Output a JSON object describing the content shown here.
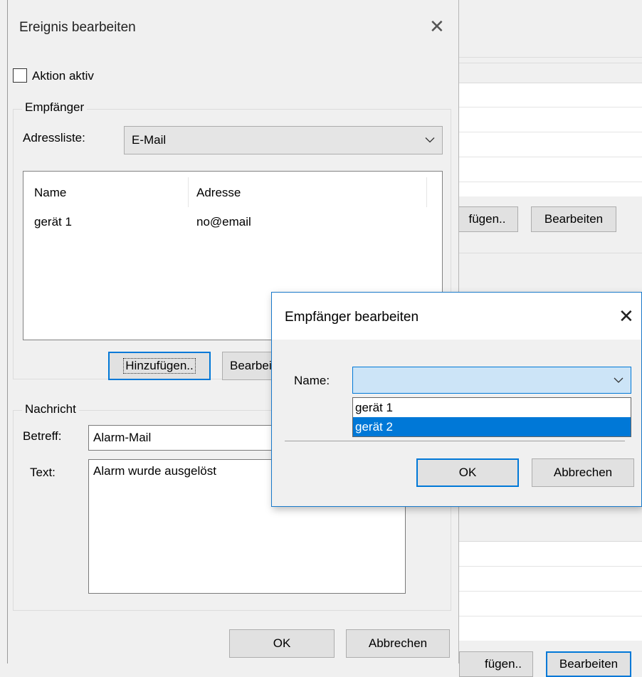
{
  "main_dialog": {
    "title": "Ereignis bearbeiten",
    "action_active_label": "Aktion aktiv",
    "recipients_group": {
      "legend": "Empfänger",
      "address_list_label": "Adressliste:",
      "address_list_value": "E-Mail",
      "columns": [
        "Name",
        "Adresse"
      ],
      "rows": [
        {
          "name": "gerät 1",
          "address": "no@email"
        }
      ],
      "add_button": "Hinzufügen..",
      "edit_button": "Bearbeiten"
    },
    "message_group": {
      "legend": "Nachricht",
      "subject_label": "Betreff:",
      "subject_value": "Alarm-Mail",
      "text_label": "Text:",
      "text_value": "Alarm wurde ausgelöst"
    },
    "ok_button": "OK",
    "cancel_button": "Abbrechen"
  },
  "background_window": {
    "add_button_partial": "fügen..",
    "edit_button": "Bearbeiten",
    "bottom_button_1_partial": "fügen..",
    "bottom_button_2_partial": "Bearbeiten"
  },
  "edit_recipient_dialog": {
    "title": "Empfänger bearbeiten",
    "name_label": "Name:",
    "name_value": "",
    "options": [
      "gerät 1",
      "gerät 2"
    ],
    "selected_option_index": 1,
    "ok_button": "OK",
    "cancel_button": "Abbrechen"
  },
  "colors": {
    "accent": "#0078d7",
    "window_bg": "#f0f0f0",
    "combo_focus_bg": "#cce4f7"
  }
}
